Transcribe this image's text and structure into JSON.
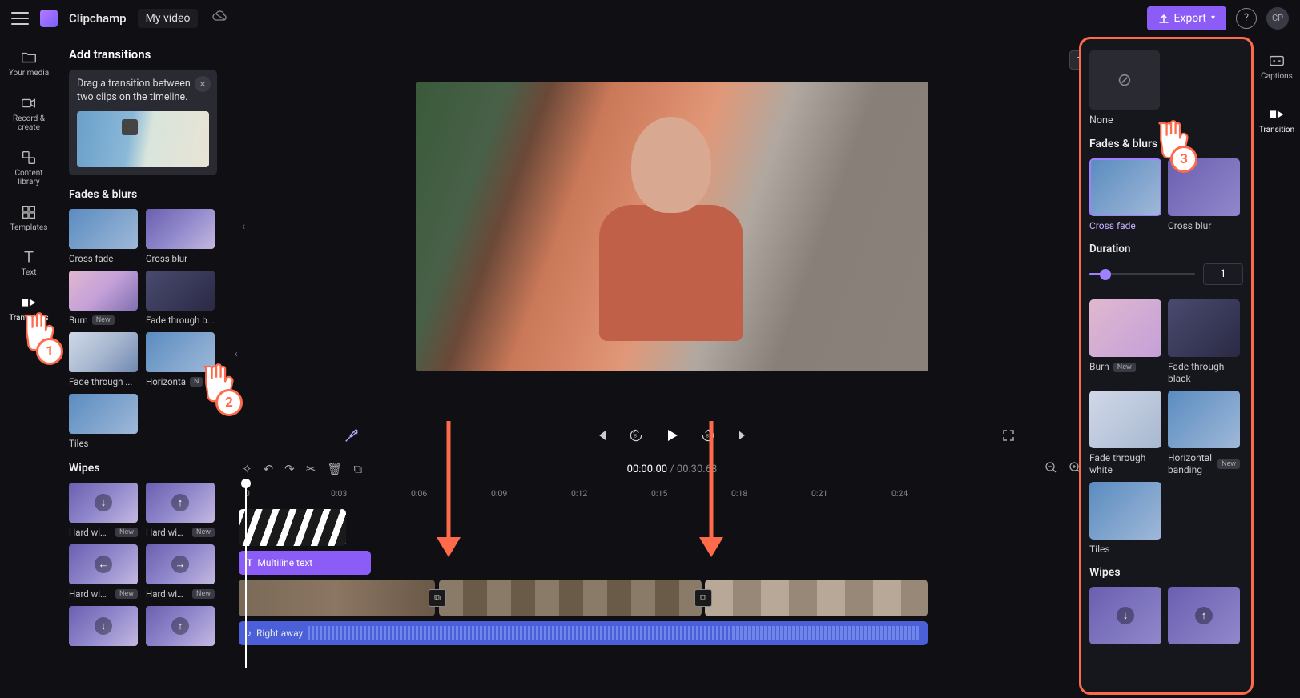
{
  "header": {
    "app_name": "Clipchamp",
    "doc_name": "My video",
    "export_label": "Export",
    "avatar_initials": "CP"
  },
  "left_rail": {
    "your_media": "Your media",
    "record": "Record & create",
    "content_library": "Content library",
    "templates": "Templates",
    "text": "Text",
    "transitions": "Transitions"
  },
  "right_rail": {
    "captions": "Captions",
    "transition": "Transition"
  },
  "panel": {
    "title": "Add transitions",
    "hint": "Drag a transition between two clips on the timeline.",
    "section_fades": "Fades & blurs",
    "section_wipes": "Wipes",
    "items": {
      "cross_fade": "Cross fade",
      "cross_blur": "Cross blur",
      "burn": "Burn",
      "fade_black": "Fade through b...",
      "fade_white": "Fade through ...",
      "horizontal": "Horizonta",
      "tiles": "Tiles",
      "hard_wipe": "Hard wip..."
    },
    "badge_new": "New"
  },
  "preview": {
    "aspect": "16:9"
  },
  "timeline": {
    "current": "00:00.00",
    "duration": "00:30.68",
    "ruler": [
      "0",
      "0:03",
      "0:06",
      "0:09",
      "0:12",
      "0:15",
      "0:18",
      "0:21",
      "0:24"
    ],
    "text_clip": "Multiline text",
    "audio_clip": "Right away"
  },
  "prop": {
    "none": "None",
    "section_fades": "Fades & blurs",
    "section_wipes": "Wipes",
    "cross_fade": "Cross fade",
    "cross_blur": "Cross blur",
    "duration_label": "Duration",
    "duration_value": "1",
    "burn": "Burn",
    "fade_black": "Fade through black",
    "fade_white": "Fade through white",
    "horizontal": "Horizontal banding",
    "tiles": "Tiles",
    "badge_new": "New"
  },
  "annotations": {
    "cursor1": "1",
    "cursor2": "2",
    "cursor3": "3"
  }
}
